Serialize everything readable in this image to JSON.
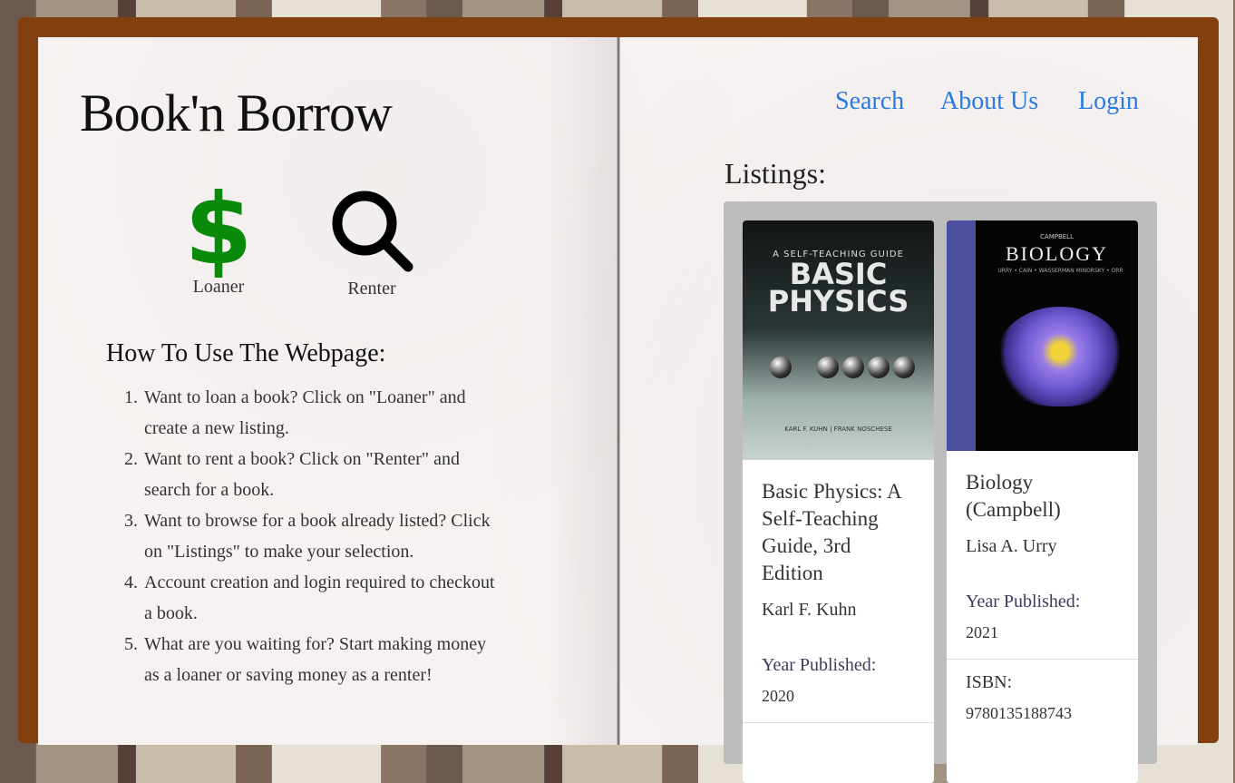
{
  "app": {
    "title": "Book'n Borrow"
  },
  "roles": [
    {
      "label": "Loaner",
      "icon": "dollar-icon",
      "color": "#0a8a0a"
    },
    {
      "label": "Renter",
      "icon": "search-icon"
    }
  ],
  "howto": {
    "heading": "How To Use The Webpage:",
    "steps": [
      "Want to loan a book? Click on \"Loaner\" and create a new listing.",
      "Want to rent a book? Click on \"Renter\" and search for a book.",
      "Want to browse for a book already listed? Click on \"Listings\" to make your selection.",
      "Account creation and login required to checkout a book.",
      "What are you waiting for? Start making money as a loaner or saving money as a renter!"
    ]
  },
  "nav": {
    "search": "Search",
    "about": "About Us",
    "login": "Login",
    "color": "#2a7ae2"
  },
  "listings": {
    "heading": "Listings:",
    "books": [
      {
        "title": "Basic Physics: A Self-Teaching Guide, 3rd Edition",
        "author": "Karl F. Kuhn",
        "year_label": "Year Published:",
        "year": "2020",
        "cover": {
          "kicker": "A SELF-TEACHING GUIDE",
          "title": "BASIC PHYSICS",
          "authors": "KARL F. KUHN | FRANK NOSCHESE"
        }
      },
      {
        "title": "Biology (Campbell)",
        "author": "Lisa A. Urry",
        "year_label": "Year Published:",
        "year": "2021",
        "isbn_label": "ISBN:",
        "isbn": "9780135188743",
        "cover": {
          "kicker": "CAMPBELL",
          "title": "BIOLOGY",
          "authors": "URRY • CAIN • WASSERMAN MINORSKY • ORR"
        }
      }
    ]
  }
}
